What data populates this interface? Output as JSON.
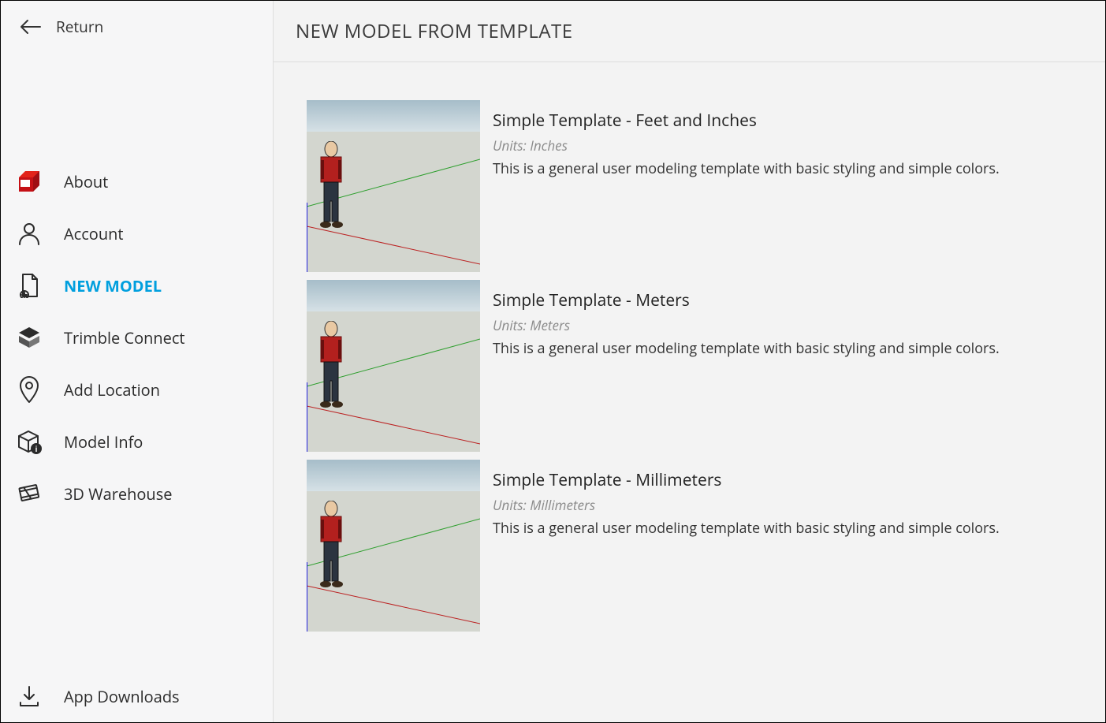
{
  "sidebar": {
    "return_label": "Return",
    "items": [
      {
        "label": "About"
      },
      {
        "label": "Account"
      },
      {
        "label": "NEW MODEL"
      },
      {
        "label": "Trimble Connect"
      },
      {
        "label": "Add Location"
      },
      {
        "label": "Model Info"
      },
      {
        "label": "3D Warehouse"
      }
    ],
    "bottom_item": {
      "label": "App Downloads"
    }
  },
  "main": {
    "title": "NEW MODEL FROM TEMPLATE",
    "templates": [
      {
        "title": "Simple Template - Feet and Inches",
        "units": "Units: Inches",
        "description": "This is a general user modeling template with basic styling and simple colors."
      },
      {
        "title": "Simple Template - Meters",
        "units": "Units: Meters",
        "description": "This is a general user modeling template with basic styling and simple colors."
      },
      {
        "title": "Simple Template - Millimeters",
        "units": "Units: Millimeters",
        "description": "This is a general user modeling template with basic styling and simple colors."
      }
    ]
  }
}
